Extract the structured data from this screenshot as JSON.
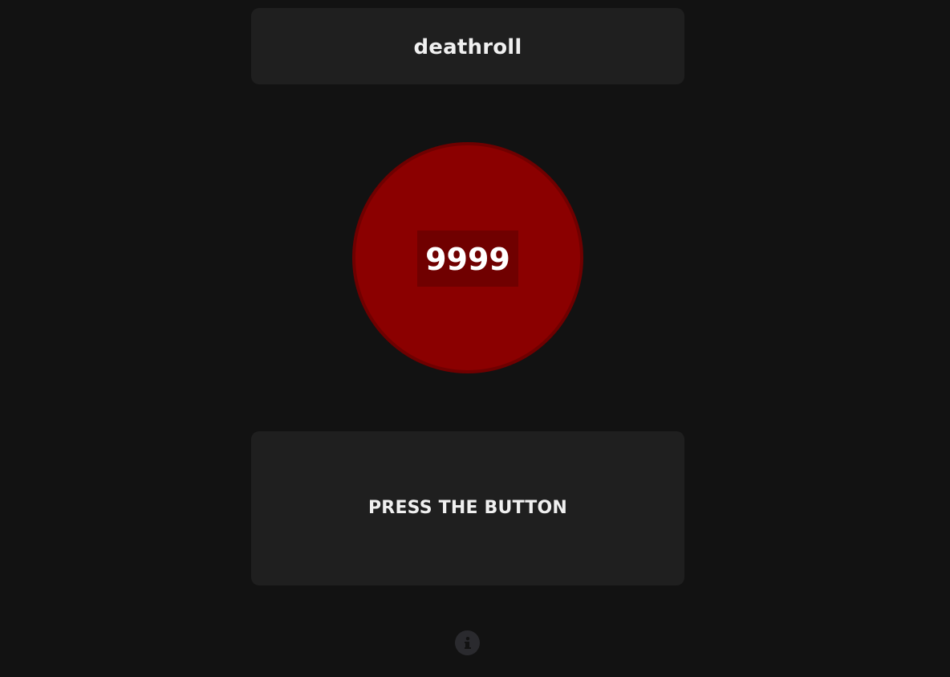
{
  "header": {
    "title": "deathroll"
  },
  "roll_button": {
    "value": "9999",
    "color": "#8b0000"
  },
  "status": {
    "message": "PRESS THE BUTTON"
  },
  "footer": {
    "info_icon": "info-icon"
  }
}
